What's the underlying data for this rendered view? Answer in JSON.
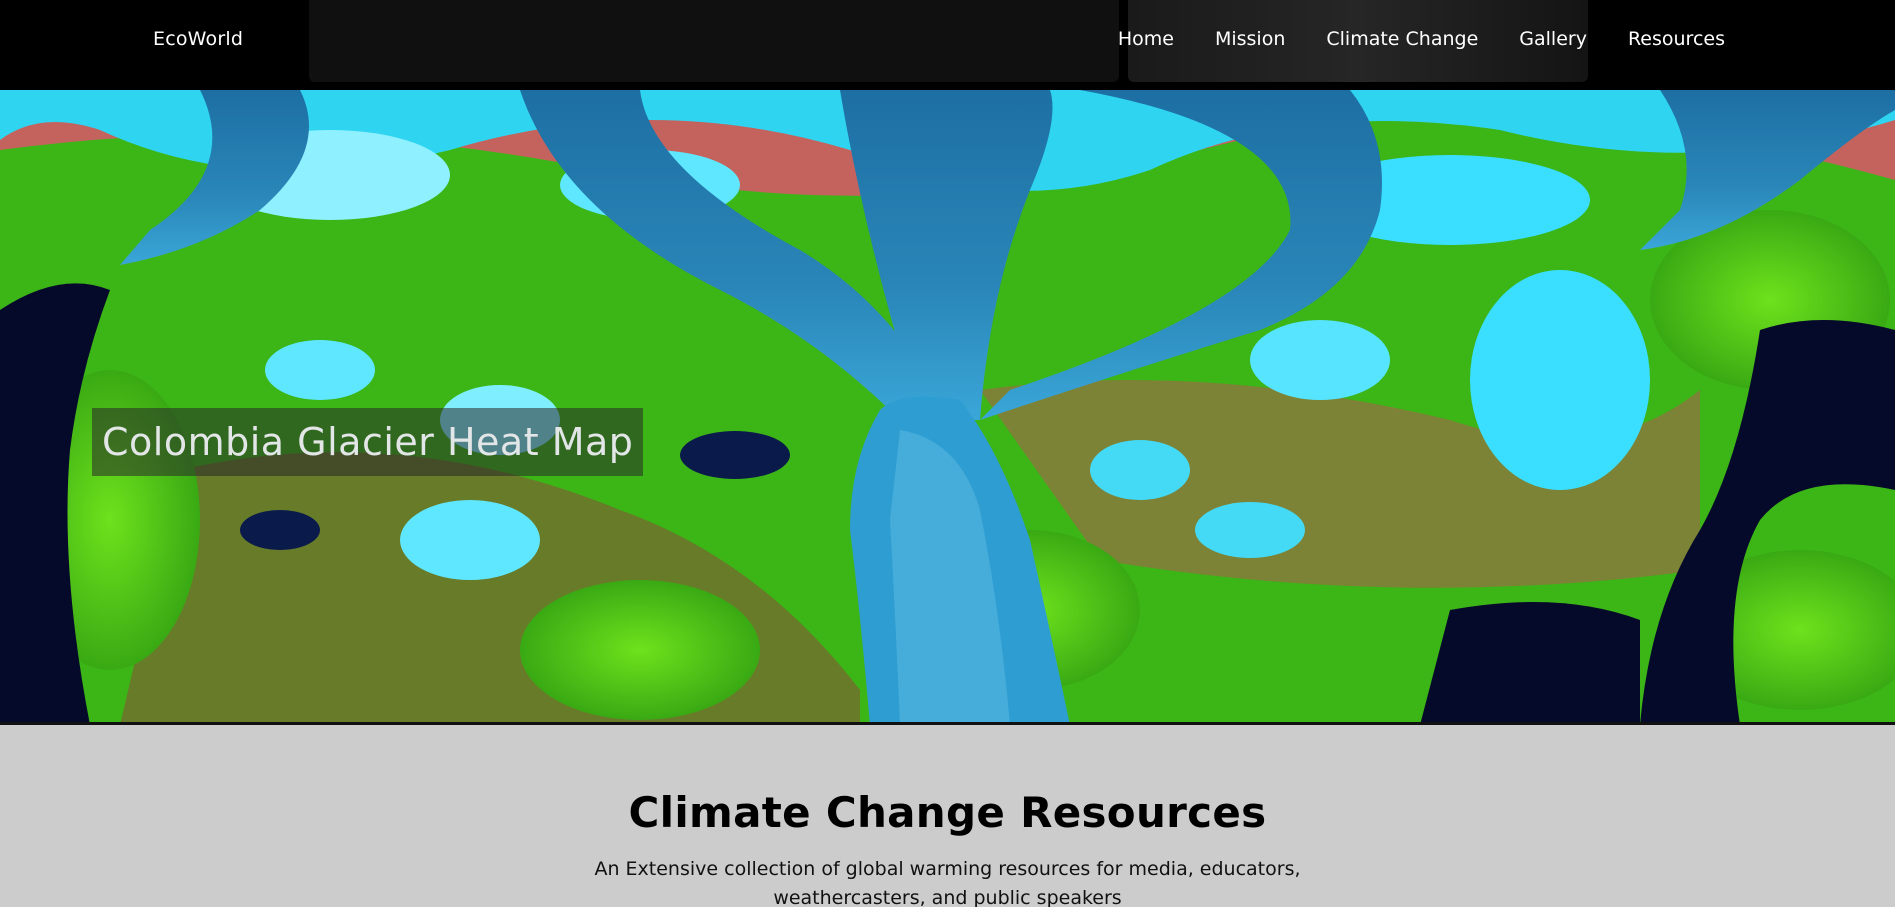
{
  "navbar": {
    "brand": "EcoWorld",
    "links": [
      {
        "label": "Home"
      },
      {
        "label": "Mission"
      },
      {
        "label": "Climate Change"
      },
      {
        "label": "Gallery"
      },
      {
        "label": "Resources"
      }
    ]
  },
  "hero": {
    "caption": "Colombia Glacier Heat Map"
  },
  "section": {
    "title": "Climate Change Resources",
    "description": "An Extensive collection of global warming resources for media, educators, weathercasters, and public speakers"
  },
  "colors": {
    "navbar_bg": "#000000",
    "page_bg": "#cccccc",
    "ice": "#33e6ff",
    "glacier": "#1f7fb0",
    "vegetation": "#4fd61a",
    "rock": "#e0706a",
    "water": "#050a2a"
  }
}
